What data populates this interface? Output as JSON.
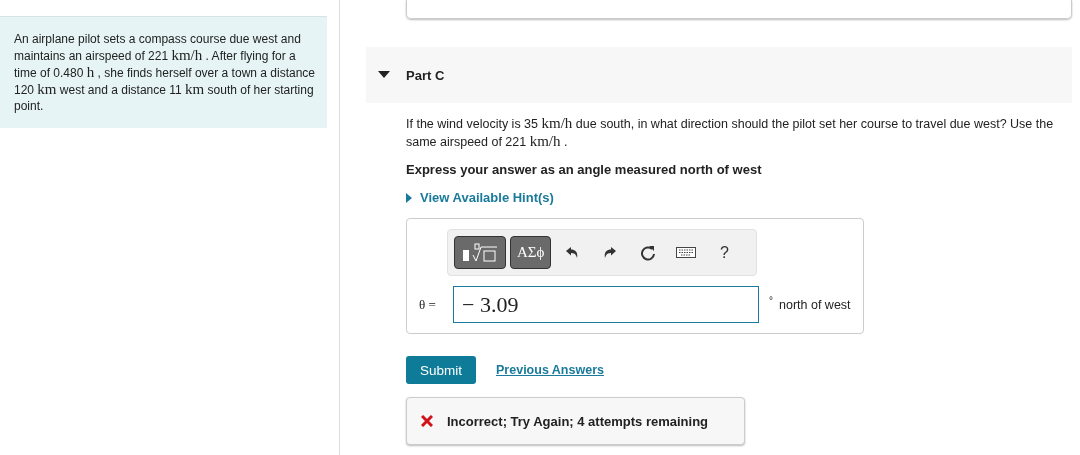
{
  "problem": {
    "segments": [
      {
        "kind": "text",
        "text": "An airplane pilot sets a compass course due west and maintains an airspeed of 221 "
      },
      {
        "kind": "math",
        "text": "km/h"
      },
      {
        "kind": "text",
        "text": " . After flying for a time of 0.480 "
      },
      {
        "kind": "math",
        "text": "h"
      },
      {
        "kind": "text",
        "text": " , she finds herself over a town a distance 120 "
      },
      {
        "kind": "math",
        "text": "km"
      },
      {
        "kind": "text",
        "text": " west and a distance 11 "
      },
      {
        "kind": "math",
        "text": "km"
      },
      {
        "kind": "text",
        "text": " south of her starting point."
      }
    ]
  },
  "part": {
    "title": "Part C",
    "expanded": true,
    "question": [
      {
        "kind": "text",
        "text": "If the wind velocity is 35 "
      },
      {
        "kind": "math",
        "text": "km/h"
      },
      {
        "kind": "text",
        "text": " due south, in what direction should the pilot set her course to travel due west? Use the same airspeed of 221 "
      },
      {
        "kind": "math",
        "text": "km/h"
      },
      {
        "kind": "text",
        "text": " ."
      }
    ],
    "instruction": "Express your answer as an angle measured north of west",
    "hints_link": "View Available Hint(s)",
    "toolbar": [
      {
        "kind": "templates"
      },
      {
        "kind": "symbols",
        "label": "ΑΣϕ"
      },
      {
        "kind": "undo"
      },
      {
        "kind": "redo"
      },
      {
        "kind": "reset"
      },
      {
        "kind": "keyboard"
      },
      {
        "kind": "help",
        "label": "?"
      }
    ],
    "answer": {
      "label": "θ =",
      "value": "− 3.09",
      "unit_mark": "°",
      "unit": "north of west"
    },
    "submit": "Submit",
    "previous": "Previous Answers",
    "feedback": {
      "correct": false,
      "text": "Incorrect; Try Again; 4 attempts remaining"
    }
  }
}
